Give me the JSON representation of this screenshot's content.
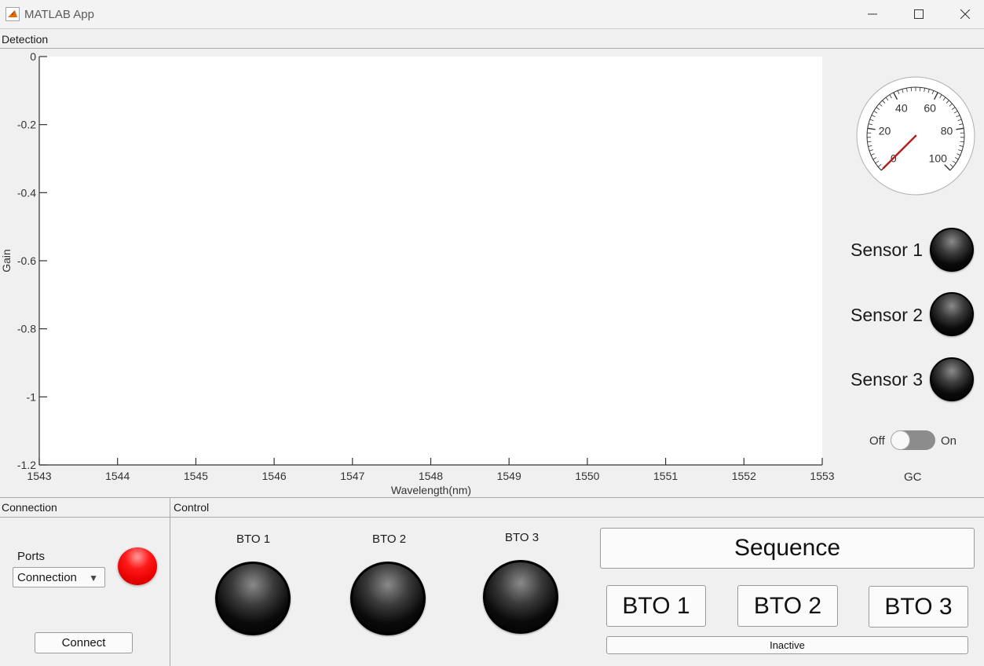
{
  "window": {
    "title": "MATLAB App"
  },
  "detection": {
    "panel_title": "Detection",
    "axes": {
      "xlabel": "Wavelength(nm)",
      "ylabel": "Gain",
      "xticks": [
        "1543",
        "1544",
        "1545",
        "1546",
        "1547",
        "1548",
        "1549",
        "1550",
        "1551",
        "1552",
        "1553"
      ],
      "yticks": [
        "0",
        "-0.2",
        "-0.4",
        "-0.6",
        "-0.8",
        "-1",
        "-1.2"
      ],
      "xlim": [
        1543,
        1553
      ],
      "ylim": [
        -1.2,
        0
      ]
    },
    "gauge": {
      "ticks": [
        "0",
        "20",
        "40",
        "60",
        "80",
        "100"
      ],
      "value": 0,
      "needle_color": "#b22222"
    },
    "sensors": [
      {
        "label": "Sensor 1"
      },
      {
        "label": "Sensor 2"
      },
      {
        "label": "Sensor 3"
      }
    ],
    "switch": {
      "off_label": "Off",
      "on_label": "On",
      "state": "Off",
      "caption": "GC"
    }
  },
  "connection": {
    "panel_title": "Connection",
    "ports_label": "Ports",
    "ports_value": "Connection",
    "status_lamp_color": "#ff0000",
    "connect_label": "Connect"
  },
  "control": {
    "panel_title": "Control",
    "lamps": [
      {
        "label": "BTO 1"
      },
      {
        "label": "BTO 2"
      },
      {
        "label": "BTO 3"
      }
    ],
    "sequence_label": "Sequence",
    "bto_buttons": [
      "BTO 1",
      "BTO 2",
      "BTO 3"
    ],
    "status_label": "Inactive"
  }
}
